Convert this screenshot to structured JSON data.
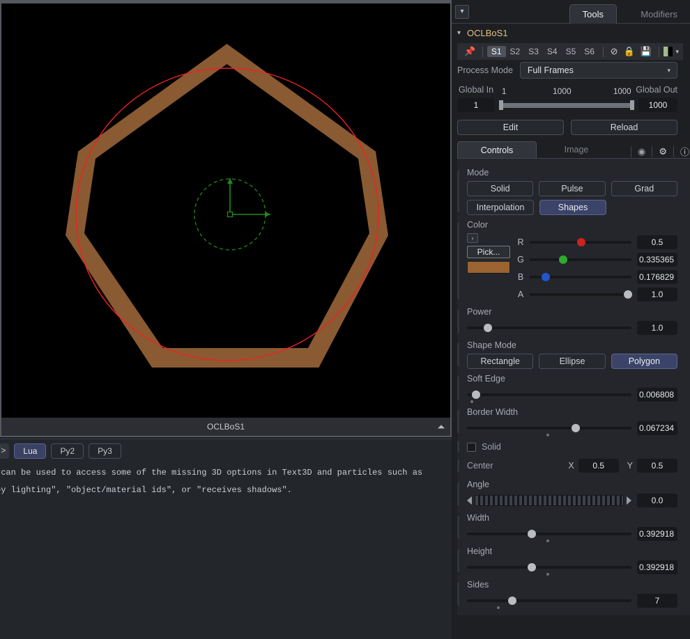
{
  "viewer": {
    "title": "OCLBoS1",
    "collapse_icon": "caret-up-icon",
    "shape": {
      "sides": 7,
      "fill_color": "#8a5a32",
      "guide_circle_color": "#ee2222",
      "center_widget_color": "#1f7a1f",
      "background": "#000000"
    }
  },
  "console": {
    "code_tag": "/>",
    "languages": [
      {
        "label": "Lua",
        "active": true
      },
      {
        "label": "Py2",
        "active": false
      },
      {
        "label": "Py3",
        "active": false
      }
    ],
    "lines": [
      " can be used to access some of the missing 3D options in Text3D and particles such as",
      "by lighting\", \"object/material ids\", or \"receives shadows\"."
    ]
  },
  "inspector": {
    "collapse_icon": "chevron-down-icon",
    "tabs": [
      {
        "label": "Tools",
        "active": true
      },
      {
        "label": "Modifiers",
        "active": false
      }
    ],
    "node": {
      "chevron": "⌄",
      "name": "OCLBoS1"
    },
    "state_bar": {
      "pin_icon": "pin-icon",
      "states": [
        "S1",
        "S2",
        "S3",
        "S4",
        "S5",
        "S6"
      ],
      "active_state": "S1",
      "disable_icon": "⊘",
      "lock_icon": "🔒",
      "save_icon": "💾",
      "swatch_caret": "▾"
    },
    "process": {
      "label": "Process Mode",
      "value": "Full Frames",
      "caret": "▾"
    },
    "globals": {
      "in_label": "Global In",
      "out_label": "Global Out",
      "in_value": "1",
      "out_value": "1000",
      "range_start_mark": "1",
      "range_mid_mark": "1000",
      "range_end_mark": "1000"
    },
    "buttons": {
      "edit": "Edit",
      "reload": "Reload"
    },
    "control_tabs": [
      {
        "label": "Controls",
        "active": true
      },
      {
        "label": "Image",
        "active": false
      }
    ],
    "control_icons": [
      "mask-icon",
      "gear-icon",
      "info-icon"
    ],
    "mode": {
      "title": "Mode",
      "row1": [
        {
          "label": "Solid",
          "selected": false
        },
        {
          "label": "Pulse",
          "selected": false
        },
        {
          "label": "Grad",
          "selected": false
        }
      ],
      "row2": [
        {
          "label": "Interpolation",
          "selected": false
        },
        {
          "label": "Shapes",
          "selected": true
        }
      ]
    },
    "color": {
      "title": "Color",
      "expand_icon": "›",
      "pick_label": "Pick...",
      "swatch_hex": "#9a6331",
      "channels": [
        {
          "name": "R",
          "value": "0.5",
          "pos": 0.51,
          "knob": "#cc2222"
        },
        {
          "name": "G",
          "value": "0.335365",
          "pos": 0.33,
          "knob": "#2faa2f"
        },
        {
          "name": "B",
          "value": "0.176829",
          "pos": 0.155,
          "knob": "#2255cc"
        },
        {
          "name": "A",
          "value": "1.0",
          "pos": 0.965,
          "knob": "#b9bcc1"
        }
      ]
    },
    "power": {
      "title": "Power",
      "value": "1.0",
      "pos": 0.125,
      "knob": "#b9bcc1"
    },
    "shape_mode": {
      "title": "Shape Mode",
      "options": [
        {
          "label": "Rectangle",
          "selected": false
        },
        {
          "label": "Ellipse",
          "selected": false
        },
        {
          "label": "Polygon",
          "selected": true
        }
      ]
    },
    "soft_edge": {
      "title": "Soft Edge",
      "value": "0.006808",
      "pos": 0.055,
      "dot": 0.03
    },
    "border_width": {
      "title": "Border Width",
      "value": "0.067234",
      "pos": 0.66,
      "dot": 0.49
    },
    "solid": {
      "label": "Solid",
      "checked": false
    },
    "center": {
      "label": "Center",
      "x_label": "X",
      "x_value": "0.5",
      "y_label": "Y",
      "y_value": "0.5"
    },
    "angle": {
      "title": "Angle",
      "value": "0.0",
      "left_arrow": "left-arrow-icon",
      "right_arrow": "right-arrow-icon"
    },
    "width": {
      "title": "Width",
      "value": "0.392918",
      "pos": 0.395,
      "dot": 0.49
    },
    "height": {
      "title": "Height",
      "value": "0.392918",
      "pos": 0.395,
      "dot": 0.49
    },
    "sides": {
      "title": "Sides",
      "value": "7",
      "pos": 0.275,
      "dot": 0.19
    }
  }
}
